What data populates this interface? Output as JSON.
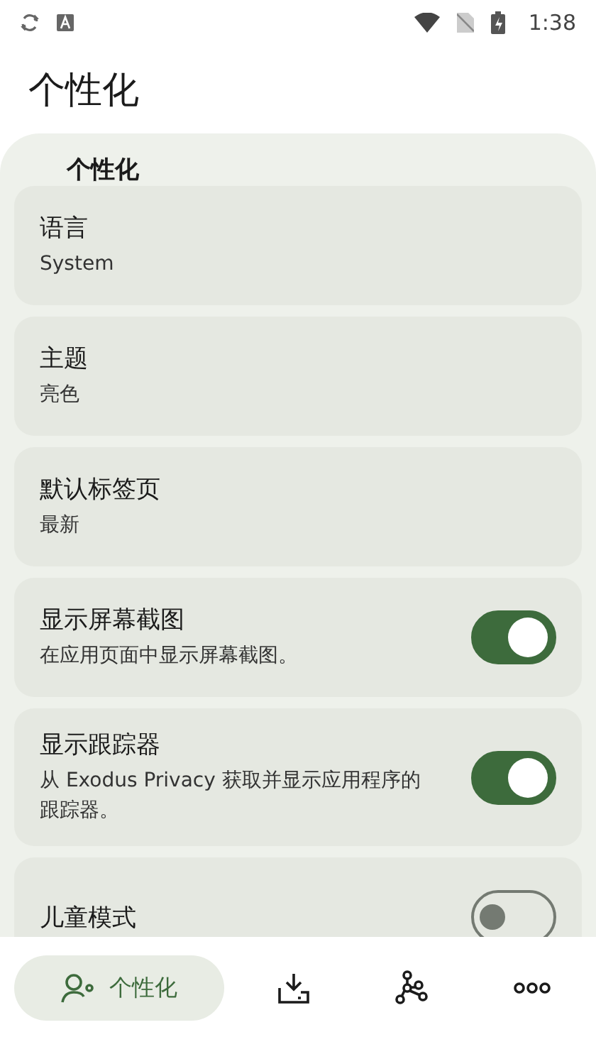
{
  "status_bar": {
    "time": "1:38"
  },
  "title": "个性化",
  "section": {
    "title": "个性化"
  },
  "items": [
    {
      "kind": "value",
      "title": "语言",
      "value": "System"
    },
    {
      "kind": "value",
      "title": "主题",
      "value": "亮色"
    },
    {
      "kind": "value",
      "title": "默认标签页",
      "value": "最新"
    },
    {
      "kind": "toggle",
      "title": "显示屏幕截图",
      "value": "在应用页面中显示屏幕截图。",
      "on": true
    },
    {
      "kind": "toggle",
      "title": "显示跟踪器",
      "value": "从 Exodus Privacy 获取并显示应用程序的跟踪器。",
      "on": true
    },
    {
      "kind": "toggle",
      "title": "儿童模式",
      "on": false
    }
  ],
  "nav": [
    {
      "kind": "person",
      "label": "个性化",
      "selected": true
    },
    {
      "kind": "download",
      "selected": false
    },
    {
      "kind": "graph",
      "selected": false
    },
    {
      "kind": "more",
      "selected": false
    }
  ]
}
